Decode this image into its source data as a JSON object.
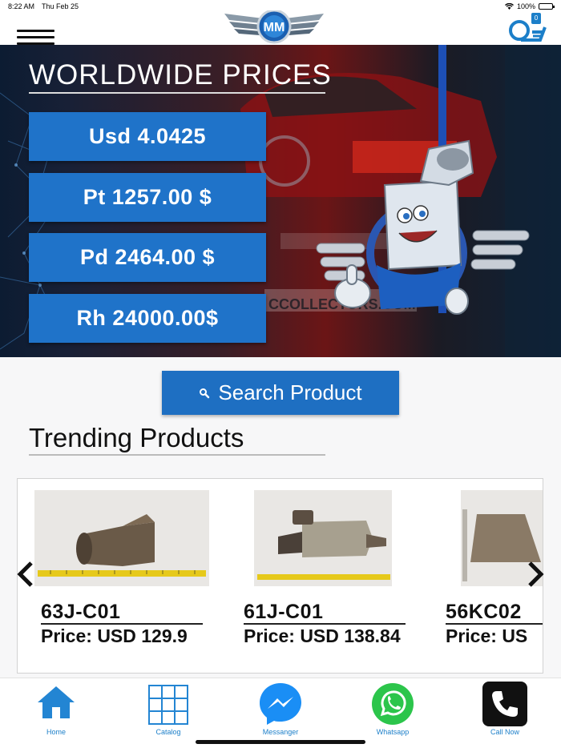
{
  "status_bar": {
    "time": "8:22 AM",
    "date": "Thu Feb 25",
    "battery": "100%",
    "battery_level": 1.0
  },
  "header": {
    "cart_count": "0"
  },
  "hero": {
    "title": "WORLDWIDE PRICES",
    "prices": [
      {
        "label": "Usd 4.0425"
      },
      {
        "label": "Pt 1257.00 $"
      },
      {
        "label": "Pd 2464.00 $"
      },
      {
        "label": "Rh 24000.00$"
      }
    ]
  },
  "search": {
    "label": "Search Product"
  },
  "trending": {
    "title": "Trending Products",
    "products": [
      {
        "code": "63J-C01",
        "price": "Price: USD 129.9"
      },
      {
        "code": "61J-C01",
        "price": "Price: USD 138.84"
      },
      {
        "code": "56KC02",
        "price": "Price: US"
      }
    ]
  },
  "bottom_nav": {
    "items": [
      {
        "label": "Home",
        "icon": "home-icon"
      },
      {
        "label": "Catalog",
        "icon": "grid-icon"
      },
      {
        "label": "Messanger",
        "icon": "messenger-icon"
      },
      {
        "label": "Whatsapp",
        "icon": "whatsapp-icon"
      },
      {
        "label": "Call Now",
        "icon": "phone-icon"
      }
    ]
  },
  "colors": {
    "accent": "#1f73c9",
    "whatsapp": "#2cc54b",
    "messenger": "#1a8ef5"
  }
}
